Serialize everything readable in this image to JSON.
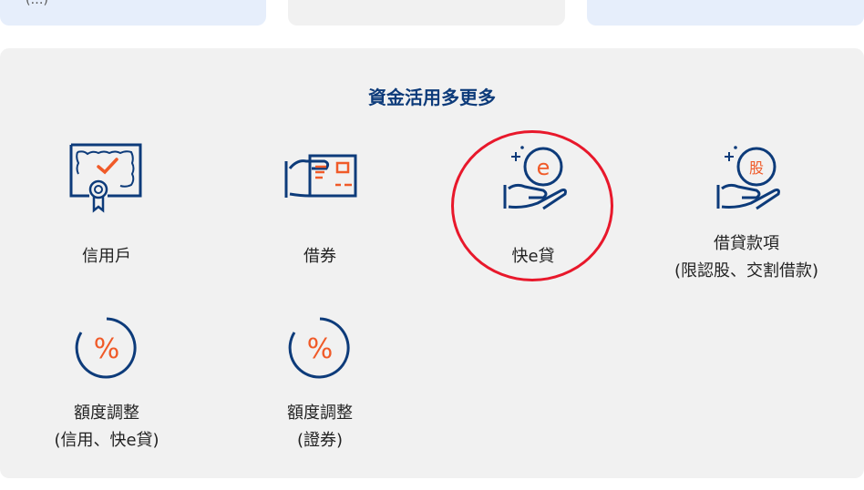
{
  "top_cards": [
    {
      "partial_text": "(…)"
    },
    {
      "partial_text": ""
    },
    {
      "partial_text": ""
    }
  ],
  "panel": {
    "title": "資金活用多更多",
    "items": [
      {
        "id": "credit-account",
        "icon": "certificate-icon",
        "label_lines": [
          "信用戶"
        ]
      },
      {
        "id": "securities-lending",
        "icon": "card-hand-icon",
        "label_lines": [
          "借券"
        ]
      },
      {
        "id": "quick-e-loan",
        "icon": "hand-coin-e-icon",
        "label_lines": [
          "快e貸"
        ],
        "highlighted": true
      },
      {
        "id": "loan-funds",
        "icon": "hand-coin-stock-icon",
        "label_lines": [
          "借貸款項",
          "(限認股、交割借款)"
        ]
      },
      {
        "id": "limit-adjust-credit",
        "icon": "percent-circle-icon",
        "label_lines": [
          "額度調整",
          "(信用、快e貸)"
        ]
      },
      {
        "id": "limit-adjust-securities",
        "icon": "percent-circle-icon",
        "label_lines": [
          "額度調整",
          "(證券)"
        ]
      }
    ]
  },
  "colors": {
    "navy": "#0d3b7a",
    "orange": "#f05a28",
    "panel_bg": "#f1f1f1",
    "highlight": "#e8182b"
  }
}
